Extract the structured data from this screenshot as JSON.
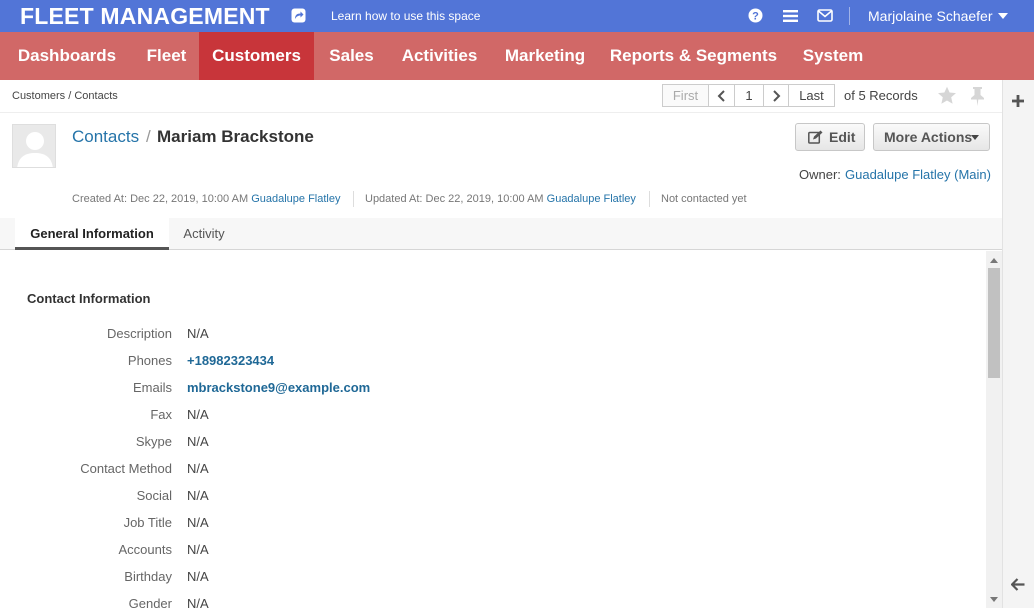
{
  "header": {
    "brand": "FLEET MANAGEMENT",
    "learn_link": "Learn how to use this space",
    "user_name": "Marjolaine Schaefer",
    "icons": [
      "share-icon",
      "help-icon",
      "menu-icon",
      "mail-icon"
    ],
    "color": "#5275d7"
  },
  "nav": {
    "color": "#d16867",
    "active_color": "#c8353a",
    "items": [
      {
        "label": "Dashboards"
      },
      {
        "label": "Fleet"
      },
      {
        "label": "Customers",
        "active": true
      },
      {
        "label": "Sales"
      },
      {
        "label": "Activities"
      },
      {
        "label": "Marketing"
      },
      {
        "label": "Reports & Segments"
      },
      {
        "label": "System"
      }
    ]
  },
  "breadcrumb": "Customers / Contacts",
  "pager": {
    "first": "First",
    "current": "1",
    "last": "Last",
    "records": "of 5 Records"
  },
  "entity": {
    "section_link": "Contacts",
    "separator": "/",
    "name": "Mariam Brackstone",
    "edit_label": "Edit",
    "more_actions_label": "More Actions",
    "owner_label": "Owner:",
    "owner_value": "Guadalupe Flatley (Main)",
    "created_text": "Created At: Dec 22, 2019, 10:00 AM",
    "created_by": "Guadalupe Flatley",
    "updated_text": "Updated At: Dec 22, 2019, 10:00 AM",
    "updated_by": "Guadalupe Flatley",
    "contact_status": "Not contacted yet"
  },
  "tabs": [
    {
      "label": "General Information",
      "active": true
    },
    {
      "label": "Activity"
    }
  ],
  "contact_info": {
    "title": "Contact Information",
    "fields": [
      {
        "label": "Description",
        "value": "N/A"
      },
      {
        "label": "Phones",
        "value": "+18982323434"
      },
      {
        "label": "Emails",
        "value": "mbrackstone9@example.com"
      },
      {
        "label": "Fax",
        "value": "N/A"
      },
      {
        "label": "Skype",
        "value": "N/A"
      },
      {
        "label": "Contact Method",
        "value": "N/A"
      },
      {
        "label": "Social",
        "value": "N/A"
      },
      {
        "label": "Job Title",
        "value": "N/A"
      },
      {
        "label": "Accounts",
        "value": "N/A"
      },
      {
        "label": "Birthday",
        "value": "N/A"
      },
      {
        "label": "Gender",
        "value": "N/A"
      }
    ]
  }
}
